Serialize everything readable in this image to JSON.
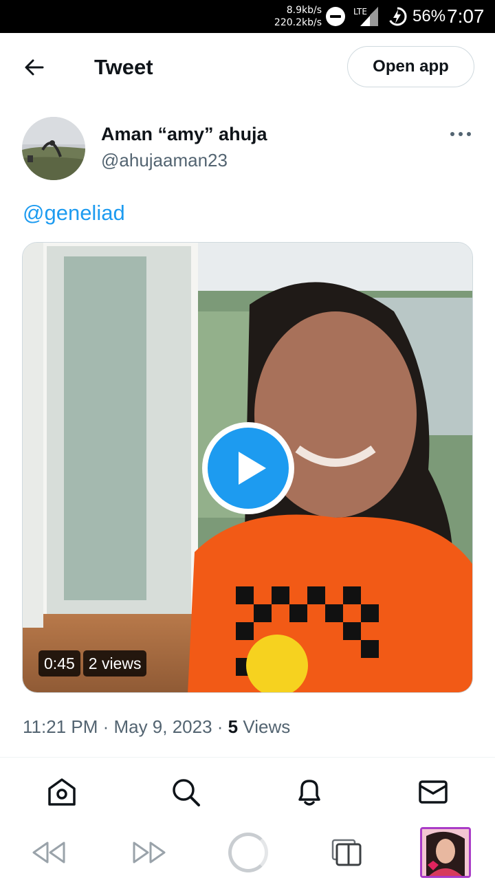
{
  "status_bar": {
    "upload_speed": "8.9kb/s",
    "download_speed": "220.2kb/s",
    "network": "LTE",
    "battery": "56%",
    "time": "7:07"
  },
  "header": {
    "title": "Tweet",
    "open_app_label": "Open app"
  },
  "tweet": {
    "display_name": "Aman “amy” ahuja",
    "handle": "@ahujaaman23",
    "text": "@geneliad",
    "video": {
      "duration": "0:45",
      "views": "2 views"
    },
    "time": "11:21 PM",
    "date": "May 9, 2023",
    "separator": " · ",
    "views_count": "5",
    "views_label": "Views"
  },
  "icons": {
    "back": "arrow-left-icon",
    "more": "more-horizontal-icon",
    "play": "play-icon",
    "nav": [
      "home-icon",
      "search-icon",
      "bell-icon",
      "mail-icon"
    ],
    "browser": [
      "rewind-icon",
      "fast-forward-icon",
      "loading-icon",
      "tabs-icon",
      "page-thumbnail"
    ]
  },
  "colors": {
    "accent": "#1d9bf0",
    "secondary_text": "#536471",
    "primary_text": "#0f1419",
    "tab_thumbnail_border": "#a93cc7"
  }
}
